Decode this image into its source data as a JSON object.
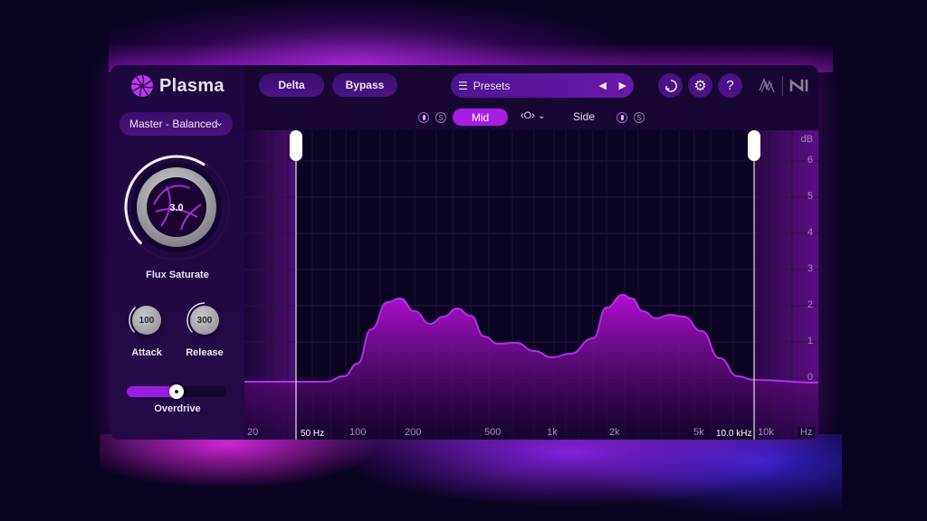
{
  "app": {
    "name": "Plasma"
  },
  "toolbar": {
    "delta_label": "Delta",
    "bypass_label": "Bypass",
    "presets_label": "Presets",
    "icons": [
      "list-icon",
      "prev-arrow-icon",
      "next-arrow-icon",
      "history-icon",
      "gear-icon",
      "help-icon",
      "izotope-logo",
      "ni-logo"
    ]
  },
  "sidebar": {
    "preset_select": "Master - Balanced",
    "flux_saturate": {
      "label": "Flux Saturate",
      "value": "3.0",
      "fraction": 0.62
    },
    "attack": {
      "label": "Attack",
      "value": "100",
      "fraction": 0.35
    },
    "release": {
      "label": "Release",
      "value": "300",
      "fraction": 0.5
    },
    "overdrive": {
      "label": "Overdrive",
      "fraction": 0.5
    }
  },
  "mid_side": {
    "mid_label": "Mid",
    "side_label": "Side",
    "link_label": "‹O›",
    "solo_label": "S",
    "active": "Mid"
  },
  "graph": {
    "low_cut_label": "50 Hz",
    "high_cut_label": "10.0 kHz",
    "freq_labels": [
      "20",
      "100",
      "200",
      "500",
      "1k",
      "2k",
      "5k",
      "10k",
      "Hz"
    ],
    "db_unit": "dB",
    "db_labels": [
      "6",
      "5",
      "4",
      "3",
      "2",
      "1",
      "0"
    ],
    "accent": "#a020e0"
  }
}
